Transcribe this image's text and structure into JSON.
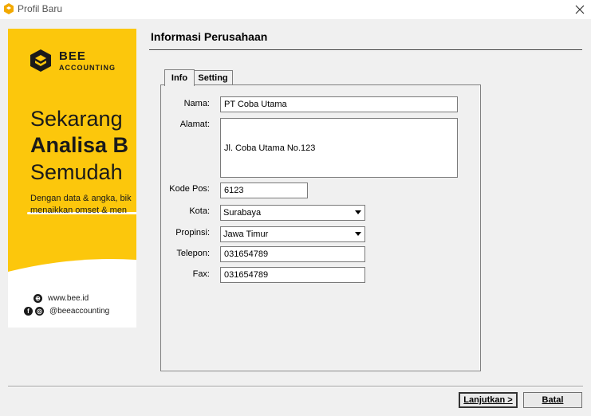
{
  "window": {
    "title": "Profil Baru"
  },
  "banner": {
    "brand_line1": "BEE",
    "brand_line2": "ACCOUNTING",
    "headline1": "Sekarang",
    "headline2": "Analisa B",
    "headline3": "Semudah",
    "sub1": "Dengan data & angka, bik",
    "sub2": "menaikkan omset & men",
    "website": "www.bee.id",
    "social": "@beeaccounting",
    "accent_color": "#fcc70c"
  },
  "section": {
    "title": "Informasi Perusahaan"
  },
  "tabs": [
    {
      "label": "Info"
    },
    {
      "label": "Setting"
    }
  ],
  "form": {
    "nama": {
      "label": "Nama:",
      "value": "PT Coba Utama"
    },
    "alamat": {
      "label": "Alamat:",
      "value": "Jl. Coba Utama No.123"
    },
    "kode_pos": {
      "label": "Kode Pos:",
      "value": "6123"
    },
    "kota": {
      "label": "Kota:",
      "value": "Surabaya"
    },
    "propinsi": {
      "label": "Propinsi:",
      "value": "Jawa Timur"
    },
    "telepon": {
      "label": "Telepon:",
      "value": "031654789"
    },
    "fax": {
      "label": "Fax:",
      "value": "031654789"
    }
  },
  "buttons": {
    "next": "Lanjutkan >",
    "cancel": "Batal"
  }
}
